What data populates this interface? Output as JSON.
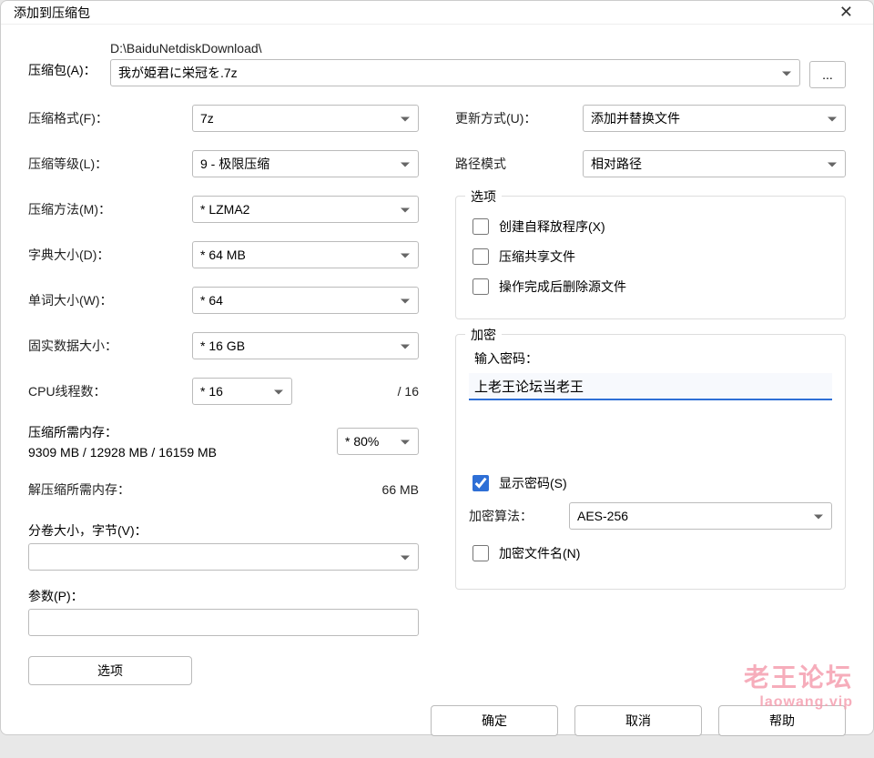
{
  "window": {
    "title": "添加到压缩包"
  },
  "archive": {
    "label": "压缩包(A)：",
    "path": "D:\\BaiduNetdiskDownload\\",
    "filename": "我が姫君に栄冠を.7z",
    "browse": "..."
  },
  "left": {
    "format": {
      "label": "压缩格式(F)：",
      "value": "7z"
    },
    "level": {
      "label": "压缩等级(L)：",
      "value": "9 - 极限压缩"
    },
    "method": {
      "label": "压缩方法(M)：",
      "value": "* LZMA2"
    },
    "dict": {
      "label": "字典大小(D)：",
      "value": "* 64 MB"
    },
    "word": {
      "label": "单词大小(W)：",
      "value": "* 64"
    },
    "solid": {
      "label": "固实数据大小：",
      "value": "* 16 GB"
    },
    "threads": {
      "label": "CPU线程数：",
      "value": "* 16",
      "total": "/ 16"
    },
    "compress_mem": {
      "label": "压缩所需内存：",
      "value": "9309 MB / 12928 MB / 16159 MB",
      "pct": "* 80%"
    },
    "decompress_mem": {
      "label": "解压缩所需内存：",
      "value": "66 MB"
    },
    "split": {
      "label": "分卷大小，字节(V)：",
      "value": ""
    },
    "params": {
      "label": "参数(P)：",
      "value": ""
    },
    "options_btn": "选项"
  },
  "right": {
    "update": {
      "label": "更新方式(U)：",
      "value": "添加并替换文件"
    },
    "pathmode": {
      "label": "路径模式",
      "value": "相对路径"
    },
    "options_group": {
      "title": "选项",
      "sfx": "创建自释放程序(X)",
      "shared": "压缩共享文件",
      "delete_after": "操作完成后删除源文件"
    },
    "encrypt_group": {
      "title": "加密",
      "pw_label": "输入密码：",
      "pw_value": "上老王论坛当老王",
      "show_pw": "显示密码(S)",
      "alg_label": "加密算法：",
      "alg_value": "AES-256",
      "encrypt_names": "加密文件名(N)"
    }
  },
  "footer": {
    "ok": "确定",
    "cancel": "取消",
    "help": "帮助"
  },
  "watermark": {
    "line1": "老王论坛",
    "line2": "laowang.vip"
  }
}
